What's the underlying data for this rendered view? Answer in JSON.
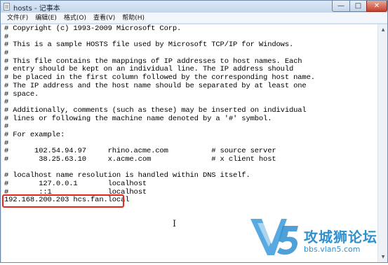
{
  "window": {
    "title": "hosts - 记事本",
    "min_glyph": "—",
    "max_glyph": "□",
    "close_glyph": "✕"
  },
  "menu": [
    "文件(F)",
    "编辑(E)",
    "格式(O)",
    "查看(V)",
    "帮助(H)"
  ],
  "lines": [
    "# Copyright (c) 1993-2009 Microsoft Corp.",
    "#",
    "# This is a sample HOSTS file used by Microsoft TCP/IP for Windows.",
    "#",
    "# This file contains the mappings of IP addresses to host names. Each",
    "# entry should be kept on an individual line. The IP address should",
    "# be placed in the first column followed by the corresponding host name.",
    "# The IP address and the host name should be separated by at least one",
    "# space.",
    "#",
    "# Additionally, comments (such as these) may be inserted on individual",
    "# lines or following the machine name denoted by a '#' symbol.",
    "#",
    "# For example:",
    "#",
    "#      102.54.94.97     rhino.acme.com          # source server",
    "#       38.25.63.10     x.acme.com              # x client host",
    "",
    "# localhost name resolution is handled within DNS itself.",
    "#\t127.0.0.1       localhost",
    "#\t::1             localhost",
    "192.168.200.203 hcs.fan.local"
  ],
  "cursor_glyph": "I",
  "watermark": {
    "brand": "攻城狮论坛",
    "url": "bbs.vlan5.com"
  },
  "colors": {
    "highlight": "#e5261f",
    "watermark": "#2f8fcf"
  },
  "scrollbar": {
    "up_glyph": "▲",
    "down_glyph": "▼"
  }
}
